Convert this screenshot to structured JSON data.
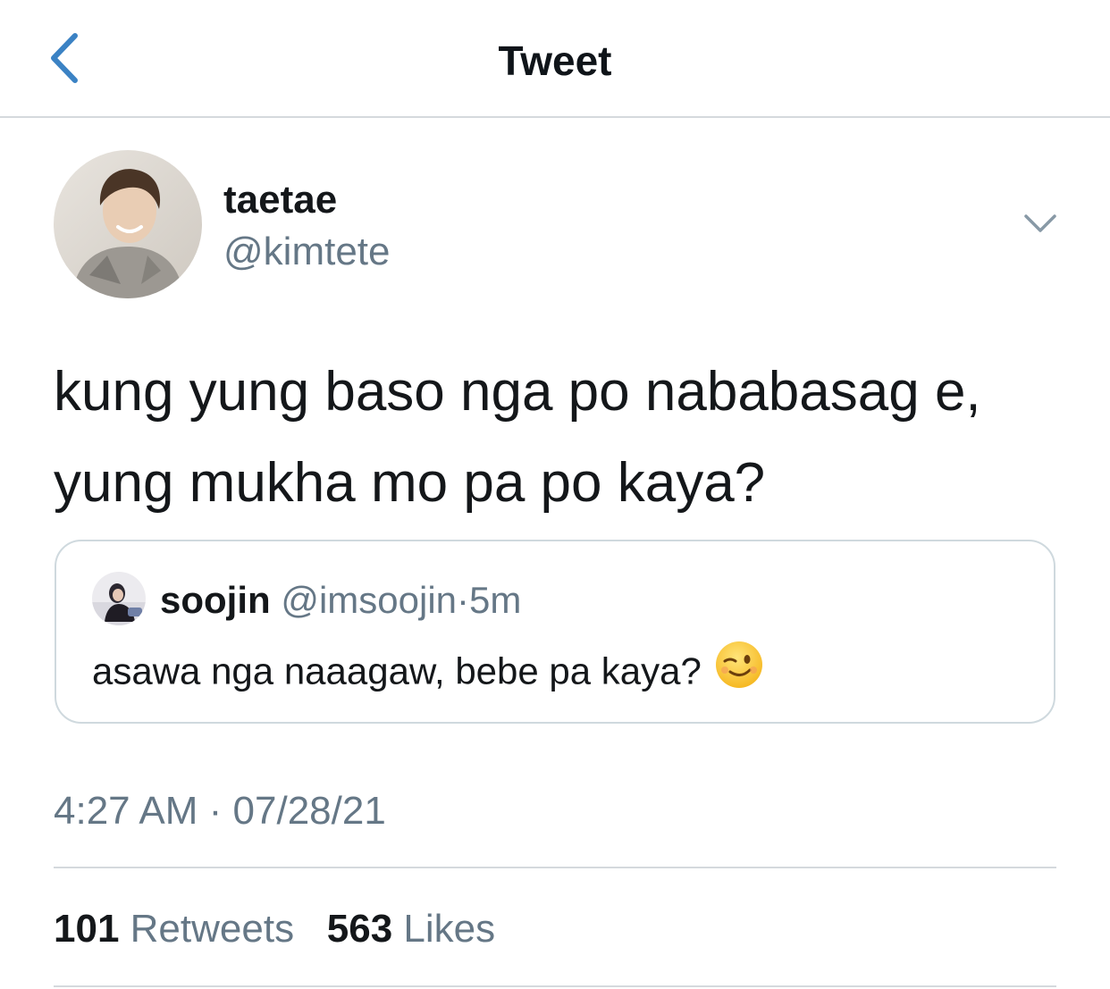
{
  "header": {
    "title": "Tweet",
    "back_icon": "chevron-left-icon"
  },
  "tweet": {
    "author": {
      "display_name": "taetae",
      "handle": "@kimtete"
    },
    "more_icon": "chevron-down-icon",
    "text": "kung yung baso nga po nababasag e,\nyung mukha mo pa po kaya?",
    "timestamp": "4:27 AM · 07/28/21"
  },
  "quoted_tweet": {
    "display_name": "soojin",
    "handle": "@imsoojin",
    "separator": "·",
    "time": "5m",
    "text": "asawa nga naaagaw, bebe pa kaya?",
    "emoji": "winking-face-emoji"
  },
  "stats": {
    "retweets_count": "101",
    "retweets_label": "Retweets",
    "likes_count": "563",
    "likes_label": "Likes"
  },
  "colors": {
    "accent": "#1da1f2",
    "back_icon": "#3b82c4",
    "secondary_text": "#657786",
    "divider": "#d5d9dd"
  }
}
